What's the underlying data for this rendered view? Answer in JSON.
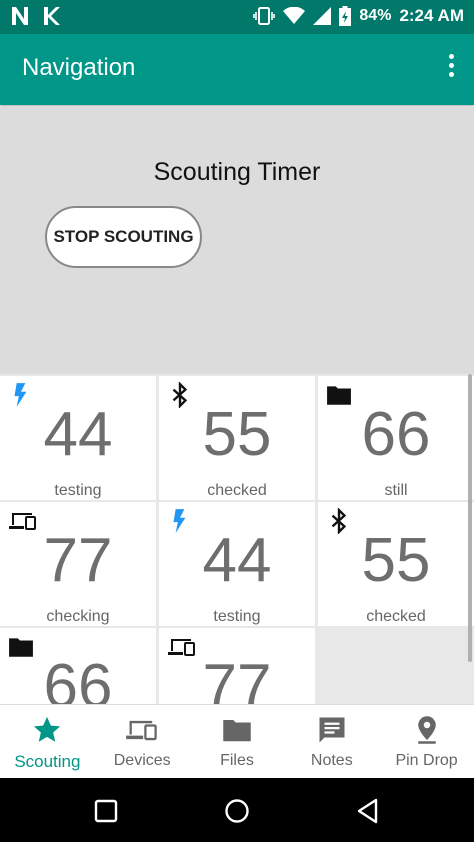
{
  "status_bar": {
    "battery": "84%",
    "time": "2:24 AM"
  },
  "app_bar": {
    "title": "Navigation"
  },
  "panel": {
    "title": "Scouting Timer",
    "stop_label": "STOP SCOUTING"
  },
  "tiles": [
    {
      "icon": "flash-icon",
      "value": "44",
      "label": "testing"
    },
    {
      "icon": "bluetooth-icon",
      "value": "55",
      "label": "checked"
    },
    {
      "icon": "folder-icon",
      "value": "66",
      "label": "still"
    },
    {
      "icon": "devices-icon",
      "value": "77",
      "label": "checking"
    },
    {
      "icon": "flash-icon",
      "value": "44",
      "label": "testing"
    },
    {
      "icon": "bluetooth-icon",
      "value": "55",
      "label": "checked"
    },
    {
      "icon": "folder-icon",
      "value": "66",
      "label": ""
    },
    {
      "icon": "devices-icon",
      "value": "77",
      "label": ""
    }
  ],
  "bottom_nav": [
    {
      "label": "Scouting",
      "icon": "star-icon",
      "active": true
    },
    {
      "label": "Devices",
      "icon": "devices-icon",
      "active": false
    },
    {
      "label": "Files",
      "icon": "folder-icon",
      "active": false
    },
    {
      "label": "Notes",
      "icon": "notes-icon",
      "active": false
    },
    {
      "label": "Pin Drop",
      "icon": "pin-icon",
      "active": false
    }
  ],
  "colors": {
    "primary": "#009688",
    "primary_dark": "#00796b",
    "flash": "#2196f3"
  }
}
